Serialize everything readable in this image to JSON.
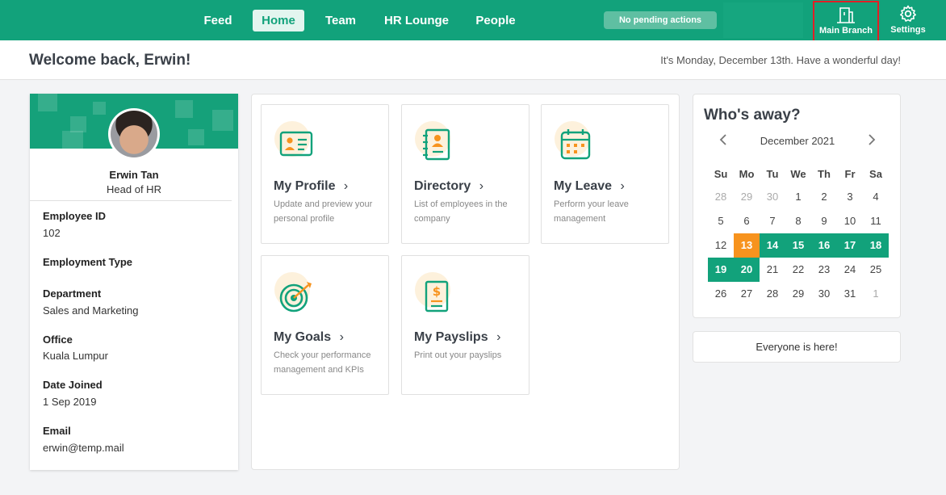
{
  "nav": {
    "items": [
      {
        "label": "Feed"
      },
      {
        "label": "Home"
      },
      {
        "label": "Team"
      },
      {
        "label": "HR Lounge"
      },
      {
        "label": "People"
      }
    ],
    "active": "Home",
    "pending_label": "No pending actions",
    "branch_label": "Main Branch",
    "settings_label": "Settings"
  },
  "header": {
    "welcome": "Welcome back, Erwin!",
    "date_message": "It's Monday, December 13th. Have a wonderful day!"
  },
  "profile": {
    "name": "Erwin Tan",
    "role": "Head of HR",
    "fields": [
      {
        "label": "Employee ID",
        "value": "102"
      },
      {
        "label": "Employment Type",
        "value": ""
      },
      {
        "label": "Department",
        "value": "Sales and Marketing"
      },
      {
        "label": "Office",
        "value": "Kuala Lumpur"
      },
      {
        "label": "Date Joined",
        "value": "1 Sep 2019"
      },
      {
        "label": "Email",
        "value": "erwin@temp.mail"
      }
    ]
  },
  "tiles": [
    {
      "title": "My Profile",
      "desc": "Update and preview your personal profile",
      "icon": "profile-card-icon"
    },
    {
      "title": "Directory",
      "desc": "List of employees in the company",
      "icon": "directory-book-icon"
    },
    {
      "title": "My Leave",
      "desc": "Perform your leave management",
      "icon": "calendar-icon"
    },
    {
      "title": "My Goals",
      "desc": "Check your performance management and KPIs",
      "icon": "target-icon"
    },
    {
      "title": "My Payslips",
      "desc": "Print out your payslips",
      "icon": "payslip-icon"
    }
  ],
  "calendar": {
    "title": "Who's away?",
    "month": "December 2021",
    "weekdays": [
      "Su",
      "Mo",
      "Tu",
      "We",
      "Th",
      "Fr",
      "Sa"
    ],
    "weeks": [
      [
        "28",
        "29",
        "30",
        "1",
        "2",
        "3",
        "4"
      ],
      [
        "5",
        "6",
        "7",
        "8",
        "9",
        "10",
        "11"
      ],
      [
        "12",
        "13",
        "14",
        "15",
        "16",
        "17",
        "18"
      ],
      [
        "19",
        "20",
        "21",
        "22",
        "23",
        "24",
        "25"
      ],
      [
        "26",
        "27",
        "28",
        "29",
        "30",
        "31",
        "1"
      ]
    ],
    "today": "13",
    "away_days": [
      "14",
      "15",
      "16",
      "17",
      "18",
      "19",
      "20"
    ]
  },
  "everyone_message": "Everyone is here!",
  "colors": {
    "brand": "#12a27b",
    "today": "#f7931e",
    "highlight_border": "#e21f26"
  }
}
